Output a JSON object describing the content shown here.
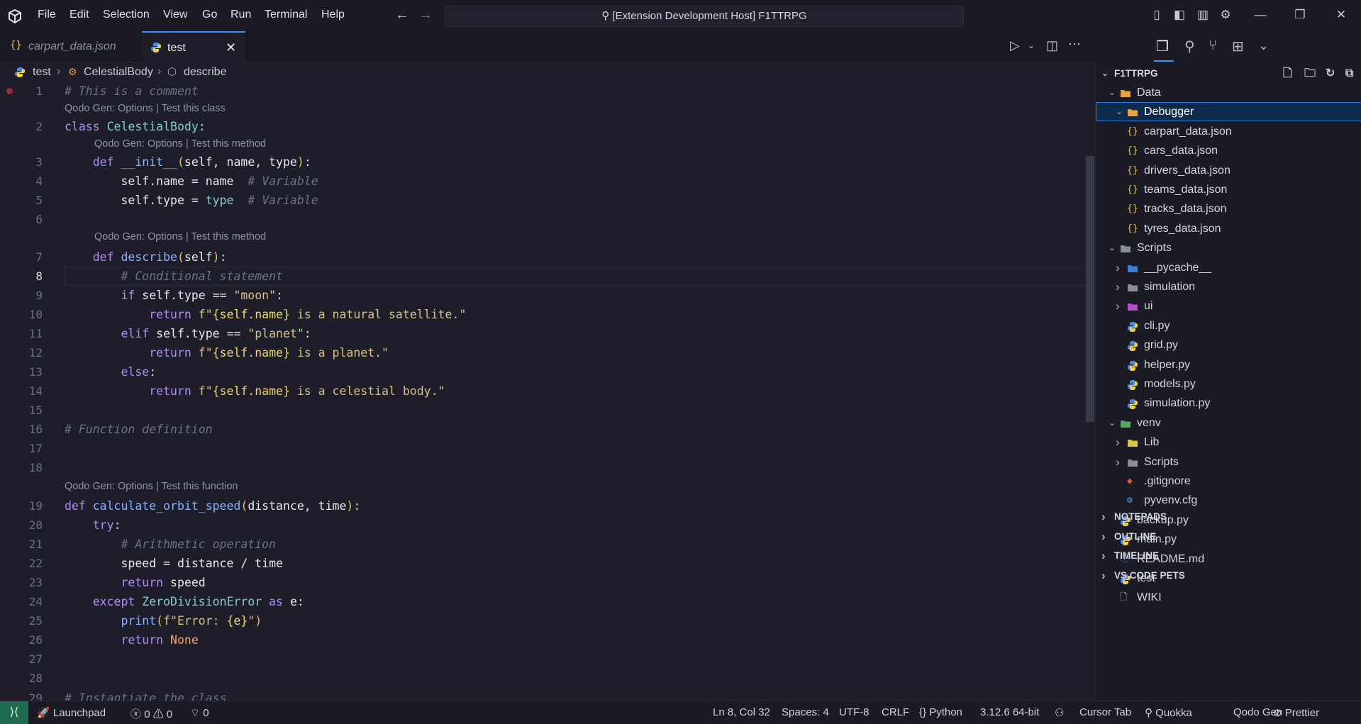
{
  "menu": [
    "File",
    "Edit",
    "Selection",
    "View",
    "Go",
    "Run",
    "Terminal",
    "Help"
  ],
  "window_title": "[Extension Development Host] F1TTRPG",
  "tabs": [
    {
      "label": "carpart_data.json",
      "active": false
    },
    {
      "label": "test",
      "active": true
    }
  ],
  "breadcrumb": [
    "test",
    "CelestialBody",
    "describe"
  ],
  "code_lens": {
    "class": "Qodo Gen: Options | Test this class",
    "method": "Qodo Gen: Options | Test this method",
    "function": "Qodo Gen: Options | Test this function"
  },
  "line_numbers": [
    "1",
    "2",
    "3",
    "4",
    "5",
    "6",
    "7",
    "8",
    "9",
    "10",
    "11",
    "12",
    "13",
    "14",
    "15",
    "16",
    "17",
    "18",
    "19",
    "20",
    "21",
    "22",
    "23",
    "24",
    "25",
    "26",
    "27",
    "28",
    "29"
  ],
  "code": {
    "l1": "# This is a comment",
    "l2_kw": "class",
    "l2_cls": "CelestialBody",
    "l3_kw": "def",
    "l3_fn": "__init__",
    "l3_params": "self, name, type",
    "l4_a": "self.name = name",
    "l4_cm": "# Variable",
    "l5_a": "self.type = ",
    "l5_b": "type",
    "l5_cm": "# Variable",
    "l7_kw": "def",
    "l7_fn": "describe",
    "l7_params": "self",
    "l8": "# Conditional statement",
    "l9_kw": "if",
    "l9_a": "self.type == ",
    "l9_str": "\"moon\"",
    "l10_kw": "return",
    "l10_f": "f\"",
    "l10_expr": "{self.name}",
    "l10_str": " is a natural satellite.\"",
    "l11_kw": "elif",
    "l11_a": "self.type == ",
    "l11_str": "\"planet\"",
    "l12_kw": "return",
    "l12_f": "f\"",
    "l12_expr": "{self.name}",
    "l12_str": " is a planet.\"",
    "l13_kw": "else",
    "l14_kw": "return",
    "l14_f": "f\"",
    "l14_expr": "{self.name}",
    "l14_str": " is a celestial body.\"",
    "l16": "# Function definition",
    "l19_kw": "def",
    "l19_fn": "calculate_orbit_speed",
    "l19_params": "distance, time",
    "l20_kw": "try",
    "l21": "# Arithmetic operation",
    "l22": "speed = distance / time",
    "l23_kw": "return",
    "l23_a": "speed",
    "l24_kw": "except",
    "l24_cls": "ZeroDivisionError",
    "l24_as": "as",
    "l24_e": "e",
    "l25_fn": "print",
    "l25_str1": "f\"Error: ",
    "l25_expr": "{e}",
    "l25_str2": "\"",
    "l26_kw": "return",
    "l26_none": "None",
    "l29": "# Instantiate the class"
  },
  "explorer": {
    "root": "F1TTRPG",
    "items": [
      {
        "label": "Data",
        "depth": 1,
        "kind": "folder-open",
        "chev": "down"
      },
      {
        "label": "Debugger",
        "depth": 2,
        "kind": "folder-open",
        "chev": "down",
        "selected": true
      },
      {
        "label": "carpart_data.json",
        "depth": 3,
        "kind": "json"
      },
      {
        "label": "cars_data.json",
        "depth": 3,
        "kind": "json"
      },
      {
        "label": "drivers_data.json",
        "depth": 3,
        "kind": "json"
      },
      {
        "label": "teams_data.json",
        "depth": 3,
        "kind": "json"
      },
      {
        "label": "tracks_data.json",
        "depth": 3,
        "kind": "json"
      },
      {
        "label": "tyres_data.json",
        "depth": 3,
        "kind": "json"
      },
      {
        "label": "Scripts",
        "depth": 1,
        "kind": "folder-open",
        "chev": "down"
      },
      {
        "label": "__pycache__",
        "depth": 2,
        "kind": "folder",
        "chev": "right"
      },
      {
        "label": "simulation",
        "depth": 2,
        "kind": "folder",
        "chev": "right"
      },
      {
        "label": "ui",
        "depth": 2,
        "kind": "folder",
        "chev": "right"
      },
      {
        "label": "cli.py",
        "depth": 3,
        "kind": "python"
      },
      {
        "label": "grid.py",
        "depth": 3,
        "kind": "python"
      },
      {
        "label": "helper.py",
        "depth": 3,
        "kind": "python"
      },
      {
        "label": "models.py",
        "depth": 3,
        "kind": "python"
      },
      {
        "label": "simulation.py",
        "depth": 3,
        "kind": "python"
      },
      {
        "label": "venv",
        "depth": 1,
        "kind": "folder-open",
        "chev": "down"
      },
      {
        "label": "Lib",
        "depth": 2,
        "kind": "folder",
        "chev": "right"
      },
      {
        "label": "Scripts",
        "depth": 2,
        "kind": "folder",
        "chev": "right"
      },
      {
        "label": ".gitignore",
        "depth": 3,
        "kind": "git"
      },
      {
        "label": "pyvenv.cfg",
        "depth": 3,
        "kind": "gear"
      },
      {
        "label": "backup.py",
        "depth": 2,
        "kind": "python"
      },
      {
        "label": "main.py",
        "depth": 2,
        "kind": "python"
      },
      {
        "label": "README.md",
        "depth": 2,
        "kind": "info"
      },
      {
        "label": "test",
        "depth": 2,
        "kind": "python"
      },
      {
        "label": "WIKI",
        "depth": 2,
        "kind": "file"
      }
    ],
    "sections": [
      "NOTEPADS",
      "OUTLINE",
      "TIMELINE",
      "VS CODE PETS"
    ]
  },
  "status": {
    "launchpad": "Launchpad",
    "errors": "0",
    "warnings": "0",
    "ports": "0",
    "position": "Ln 8, Col 32",
    "spaces": "Spaces: 4",
    "encoding": "UTF-8",
    "eol": "CRLF",
    "language": "Python",
    "interpreter": "3.12.6 64-bit",
    "cursor_tab": "Cursor Tab",
    "quokka": "Quokka",
    "qodo": "Qodo Gen",
    "prettier": "Prettier"
  },
  "colors": {
    "accent": "#3794ff",
    "remote": "#1f6b4f",
    "breakpoint": "#a1262d"
  }
}
